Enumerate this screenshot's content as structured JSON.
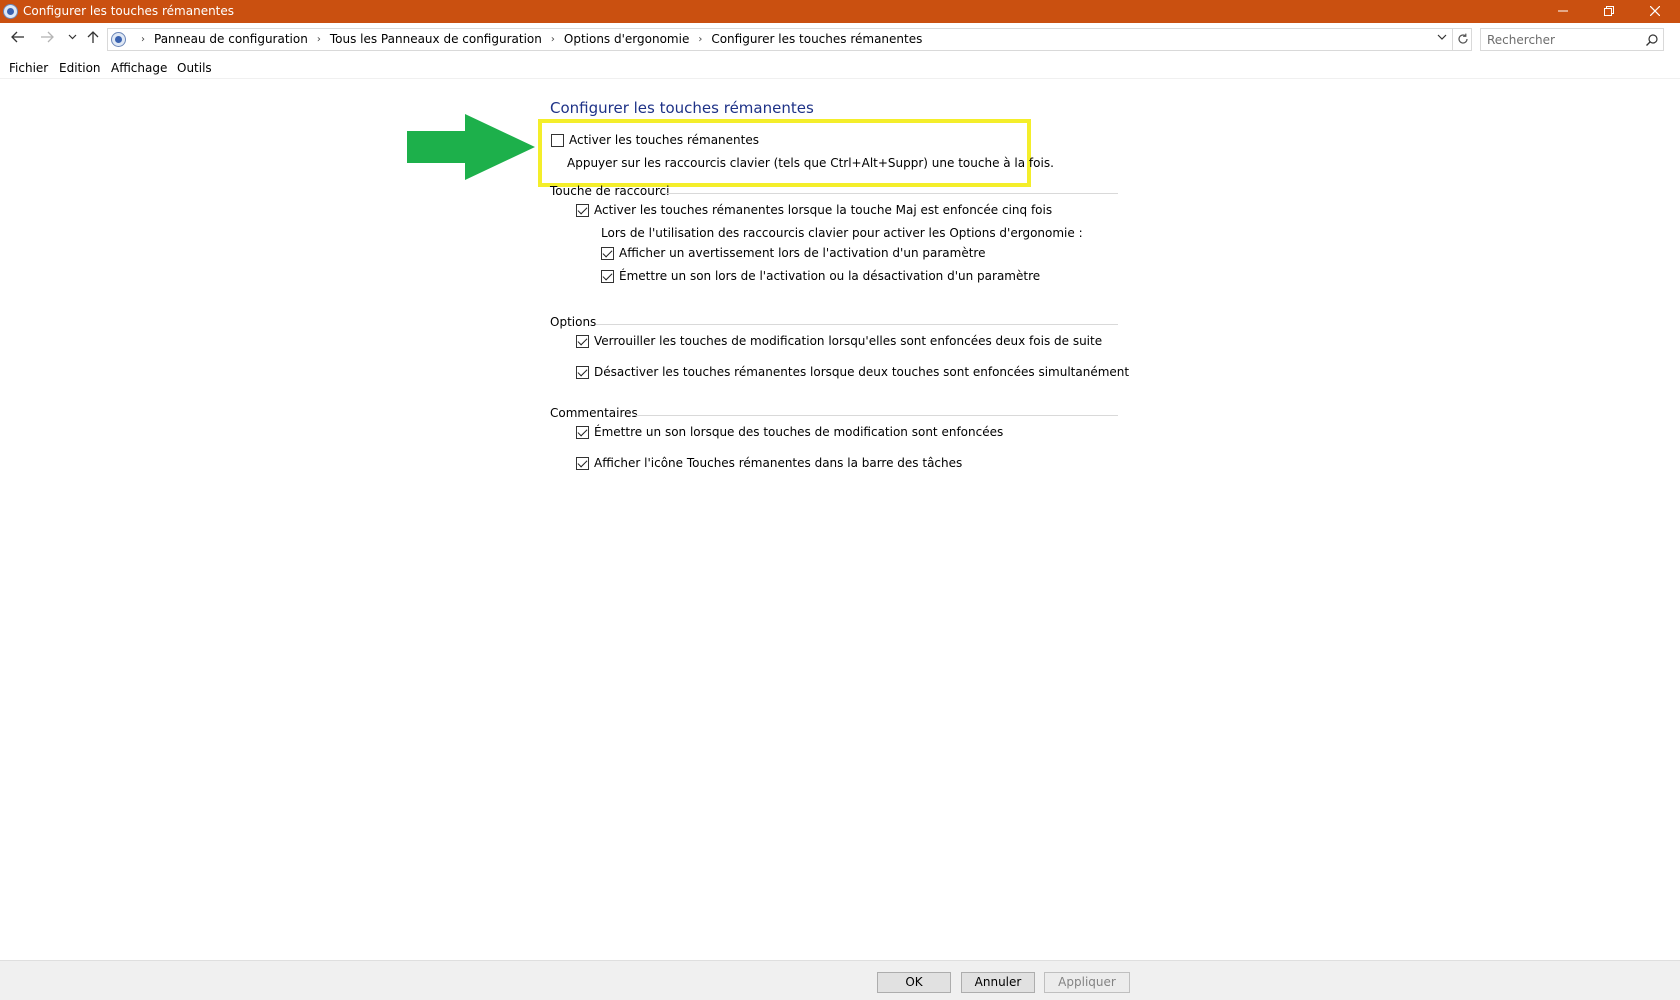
{
  "window": {
    "title": "Configurer les touches rémanentes",
    "controls": {
      "minimize": "minimize-icon",
      "restore": "restore-icon",
      "close": "close-icon"
    },
    "accent_color": "#ca5010"
  },
  "address_bar": {
    "breadcrumbs": [
      "Panneau de configuration",
      "Tous les Panneaux de configuration",
      "Options d'ergonomie",
      "Configurer les touches rémanentes"
    ],
    "search_placeholder": "Rechercher"
  },
  "menu": [
    "Fichier",
    "Edition",
    "Affichage",
    "Outils"
  ],
  "main": {
    "title": "Configurer les touches rémanentes",
    "title_color": "#1e3287",
    "enable": {
      "label": "Activer les touches rémanentes",
      "checked": false,
      "description": "Appuyer sur les raccourcis clavier (tels que Ctrl+Alt+Suppr) une touche à la fois."
    },
    "highlight_color": "#f4ee2a",
    "arrow_color": "#1db04b",
    "shortcut_group": {
      "heading": "Touche de raccourci",
      "shift_five": {
        "label": "Activer les touches rémanentes lorsque la touche Maj est enfoncée cinq fois",
        "checked": true
      },
      "intro": "Lors de l'utilisation des raccourcis clavier pour activer les Options d'ergonomie :",
      "warning": {
        "label": "Afficher un avertissement lors de l'activation d'un paramètre",
        "checked": true
      },
      "sound": {
        "label": "Émettre un son lors de l'activation ou la désactivation d'un paramètre",
        "checked": true
      }
    },
    "options_group": {
      "heading": "Options",
      "lock": {
        "label": "Verrouiller les touches de modification lorsqu'elles sont enfoncées deux fois de suite",
        "checked": true
      },
      "disable": {
        "label": "Désactiver les touches rémanentes lorsque deux touches sont enfoncées simultanément",
        "checked": true
      }
    },
    "feedback_group": {
      "heading": "Commentaires",
      "sound": {
        "label": "Émettre un son lorsque des touches de modification sont enfoncées",
        "checked": true
      },
      "icon": {
        "label": "Afficher l'icône Touches rémanentes dans la barre des tâches",
        "checked": true
      }
    }
  },
  "footer": {
    "ok": "OK",
    "cancel": "Annuler",
    "apply": "Appliquer"
  }
}
